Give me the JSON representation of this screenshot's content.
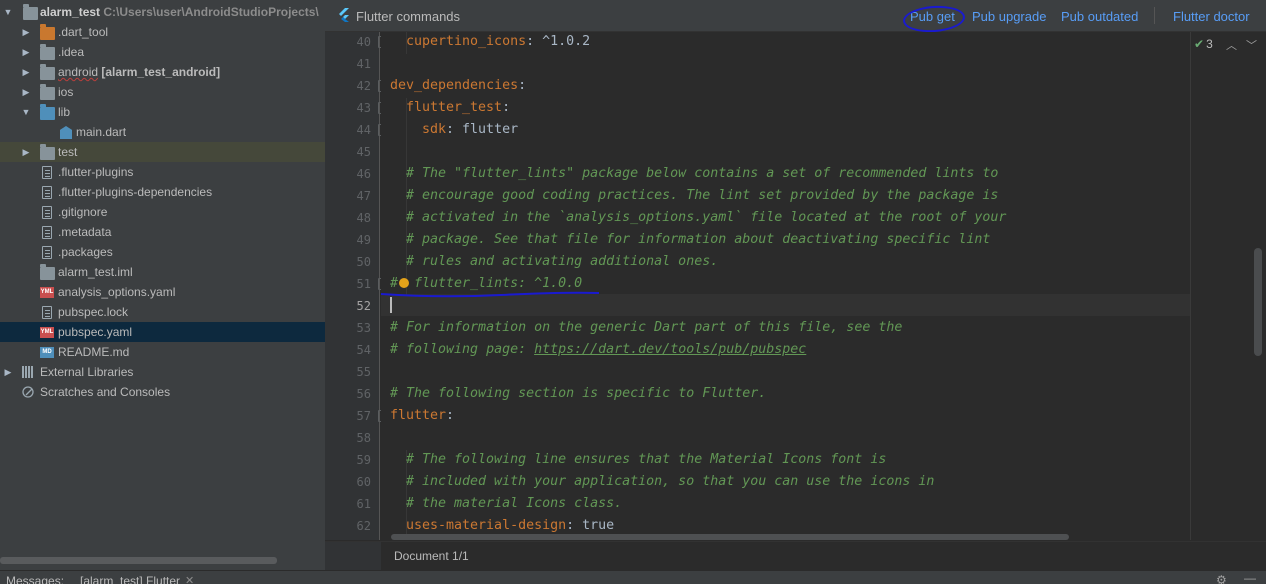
{
  "project_tree": {
    "root": {
      "name": "alarm_test",
      "path": "C:\\Users\\user\\AndroidStudioProjects\\"
    },
    "items": [
      {
        "label": ".dart_tool"
      },
      {
        "label": ".idea"
      },
      {
        "label": "android",
        "suffix": "[alarm_test_android]"
      },
      {
        "label": "ios"
      },
      {
        "label": "lib"
      },
      {
        "label": "main.dart"
      },
      {
        "label": "test"
      },
      {
        "label": ".flutter-plugins"
      },
      {
        "label": ".flutter-plugins-dependencies"
      },
      {
        "label": ".gitignore"
      },
      {
        "label": ".metadata"
      },
      {
        "label": ".packages"
      },
      {
        "label": "alarm_test.iml"
      },
      {
        "label": "analysis_options.yaml"
      },
      {
        "label": "pubspec.lock"
      },
      {
        "label": "pubspec.yaml"
      },
      {
        "label": "README.md"
      },
      {
        "label": "External Libraries"
      },
      {
        "label": "Scratches and Consoles"
      }
    ],
    "icon_text": {
      "yml": "YML",
      "md": "MD"
    }
  },
  "editor_header": {
    "title": "Flutter commands",
    "actions": [
      "Pub get",
      "Pub upgrade",
      "Pub outdated",
      "Flutter doctor"
    ]
  },
  "inspections": {
    "count": "3"
  },
  "line_numbers": [
    "40",
    "41",
    "42",
    "43",
    "44",
    "45",
    "46",
    "47",
    "48",
    "49",
    "50",
    "51",
    "52",
    "53",
    "54",
    "55",
    "56",
    "57",
    "58",
    "59",
    "60",
    "61",
    "62"
  ],
  "code": {
    "l40_key": "cupertino_icons",
    "l40_val": ": ^1.0.2",
    "l42_key": "dev_dependencies",
    "l42_colon": ":",
    "l43_key": "flutter_test",
    "l43_colon": ":",
    "l44_key": "sdk",
    "l44_val": ": flutter",
    "l46": "# The \"flutter_lints\" package below contains a set of recommended lints to",
    "l47": "# encourage good coding practices. The lint set provided by the package is",
    "l48": "# activated in the `analysis_options.yaml` file located at the root of your",
    "l49": "# package. See that file for information about deactivating specific lint",
    "l50": "# rules and activating additional ones.",
    "l51": "#  flutter_lints: ^1.0.0",
    "l53": "# For information on the generic Dart part of this file, see the",
    "l54_prefix": "# following page: ",
    "l54_link": "https://dart.dev/tools/pub/pubspec",
    "l56": "# The following section is specific to Flutter.",
    "l57_key": "flutter",
    "l57_colon": ":",
    "l59": "# The following line ensures that the Material Icons font is",
    "l60": "# included with your application, so that you can use the icons in",
    "l61": "# the material Icons class.",
    "l62_key": "uses-material-design",
    "l62_val": ": true"
  },
  "breadcrumb": "Document 1/1",
  "messages": {
    "label": "Messages:",
    "tab": "[alarm_test] Flutter"
  },
  "colors": {
    "keyword": "#cc7832",
    "comment": "#629755",
    "link": "#589df6",
    "annotation": "#1a1ad0"
  }
}
